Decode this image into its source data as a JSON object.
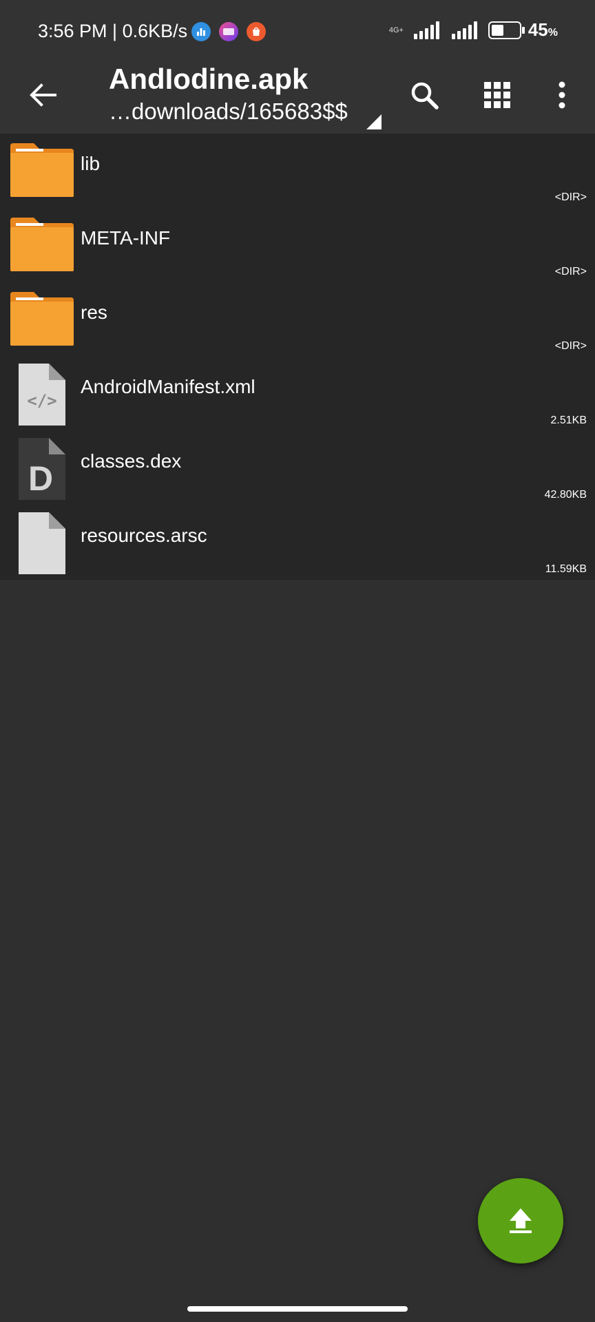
{
  "status_bar": {
    "time_speed": "3:56 PM | 0.6KB/s",
    "network_type": "4G+",
    "battery_level": "45",
    "battery_unit": "%",
    "icons": [
      "chart-app-icon",
      "lazada-app-icon",
      "shopee-app-icon",
      "signal-icon",
      "signal-icon",
      "battery-icon"
    ]
  },
  "toolbar": {
    "title": "AndIodine.apk",
    "path": "…downloads/165683$$",
    "icons": [
      "back-arrow-icon",
      "search-icon",
      "grid-view-icon",
      "more-vert-icon"
    ]
  },
  "files": [
    {
      "name": "lib",
      "meta": "<DIR>",
      "icon": "folder-icon"
    },
    {
      "name": "META-INF",
      "meta": "<DIR>",
      "icon": "folder-icon"
    },
    {
      "name": "res",
      "meta": "<DIR>",
      "icon": "folder-icon"
    },
    {
      "name": "AndroidManifest.xml",
      "meta": "2.51KB",
      "icon": "xml-file-icon"
    },
    {
      "name": "classes.dex",
      "meta": "42.80KB",
      "icon": "dex-file-icon",
      "icon_letter": "D"
    },
    {
      "name": "resources.arsc",
      "meta": "11.59KB",
      "icon": "generic-file-icon"
    }
  ],
  "fab": {
    "icon": "upload-icon"
  },
  "colors": {
    "background": "#2f2f2f",
    "bar": "#333333",
    "list_background": "#262626",
    "folder": "#f5a233",
    "folder_dark": "#e8871e",
    "fab": "#5ba314"
  }
}
